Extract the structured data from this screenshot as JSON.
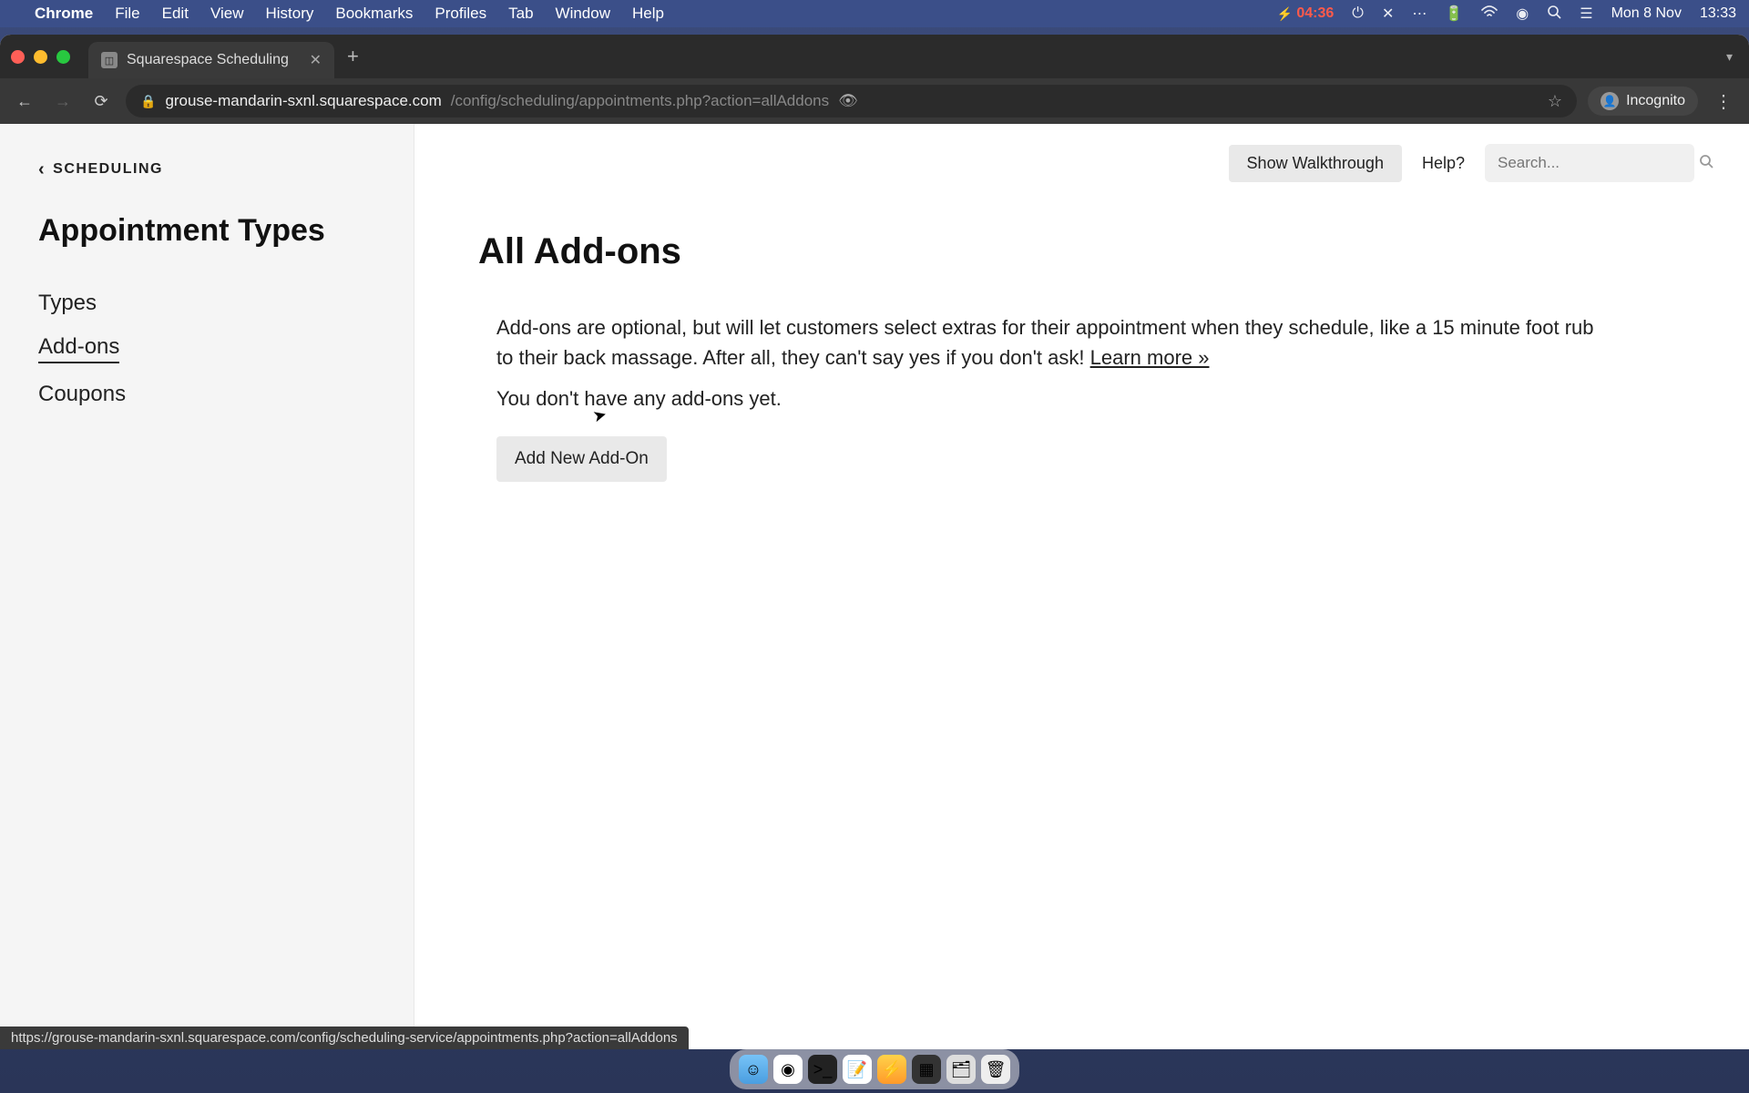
{
  "menubar": {
    "app": "Chrome",
    "items": [
      "File",
      "Edit",
      "View",
      "History",
      "Bookmarks",
      "Profiles",
      "Tab",
      "Window",
      "Help"
    ],
    "battery_time": "04:36",
    "date": "Mon 8 Nov",
    "time": "13:33"
  },
  "browser": {
    "tab_title": "Squarespace Scheduling",
    "url_main": "grouse-mandarin-sxnl.squarespace.com",
    "url_rest": "/config/scheduling/appointments.php?action=allAddons",
    "incognito_label": "Incognito",
    "status_url": "https://grouse-mandarin-sxnl.squarespace.com/config/scheduling-service/appointments.php?action=allAddons"
  },
  "sidebar": {
    "back_label": "SCHEDULING",
    "heading": "Appointment Types",
    "items": [
      {
        "label": "Types",
        "active": false
      },
      {
        "label": "Add-ons",
        "active": true
      },
      {
        "label": "Coupons",
        "active": false
      }
    ]
  },
  "topbar": {
    "show_walkthrough": "Show Walkthrough",
    "help": "Help?",
    "search_placeholder": "Search..."
  },
  "main": {
    "title": "All Add-ons",
    "description": "Add-ons are optional, but will let customers select extras for their appointment when they schedule, like a 15 minute foot rub to their back massage. After all, they can't say yes if you don't ask! ",
    "learn_more": "Learn more »",
    "empty": "You don't have any add-ons yet.",
    "add_button": "Add New Add-On"
  }
}
